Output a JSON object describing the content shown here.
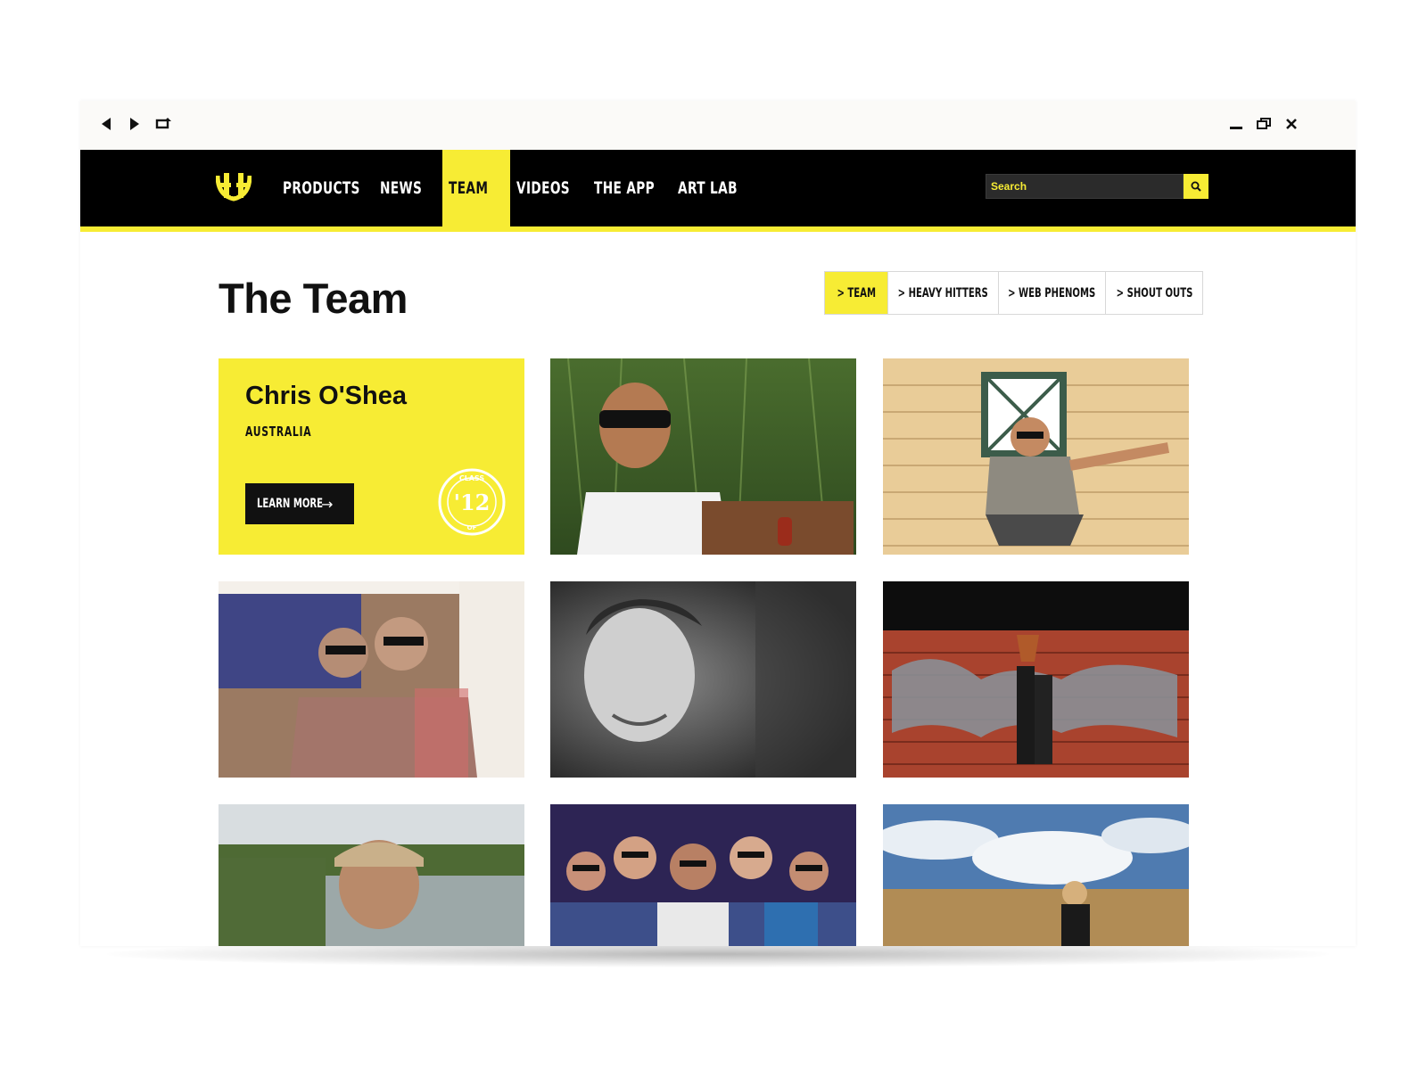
{
  "window": {
    "controls": {
      "back": "back-arrow-icon",
      "forward": "forward-arrow-icon",
      "refresh": "refresh-icon",
      "minimize": "minimize-icon",
      "restore": "restore-icon",
      "close": "close-icon"
    }
  },
  "colors": {
    "accent": "#f7ec34",
    "nav_bg": "#000000",
    "text": "#111111"
  },
  "nav": {
    "logo": "hh-logo",
    "items": [
      {
        "label": "PRODUCTS",
        "active": false
      },
      {
        "label": "NEWS",
        "active": false
      },
      {
        "label": "TEAM",
        "active": true
      },
      {
        "label": "VIDEOS",
        "active": false
      },
      {
        "label": "THE APP",
        "active": false
      },
      {
        "label": "ART LAB",
        "active": false
      }
    ],
    "search_placeholder": "Search",
    "search_icon": "search-icon"
  },
  "page": {
    "title": "The Team",
    "tabs": [
      {
        "label": "> TEAM",
        "active": true
      },
      {
        "label": "> HEAVY HITTERS",
        "active": false
      },
      {
        "label": "> WEB PHENOMS",
        "active": false
      },
      {
        "label": "> SHOUT OUTS",
        "active": false
      }
    ]
  },
  "featured": {
    "name": "Chris O'Shea",
    "country": "AUSTRALIA",
    "cta": "LEARN MORE",
    "cta_icon": "right-arrow-icon",
    "badge": {
      "top": "CLASS",
      "year": "'12",
      "bottom": "OF"
    }
  },
  "tiles": [
    "team-photo-cornfield",
    "team-photo-jump",
    "team-photo-collage",
    "team-photo-portrait-bw",
    "team-photo-graffiti-wall",
    "team-photo-lake-cap",
    "team-photo-crowd",
    "team-photo-field-sky"
  ]
}
